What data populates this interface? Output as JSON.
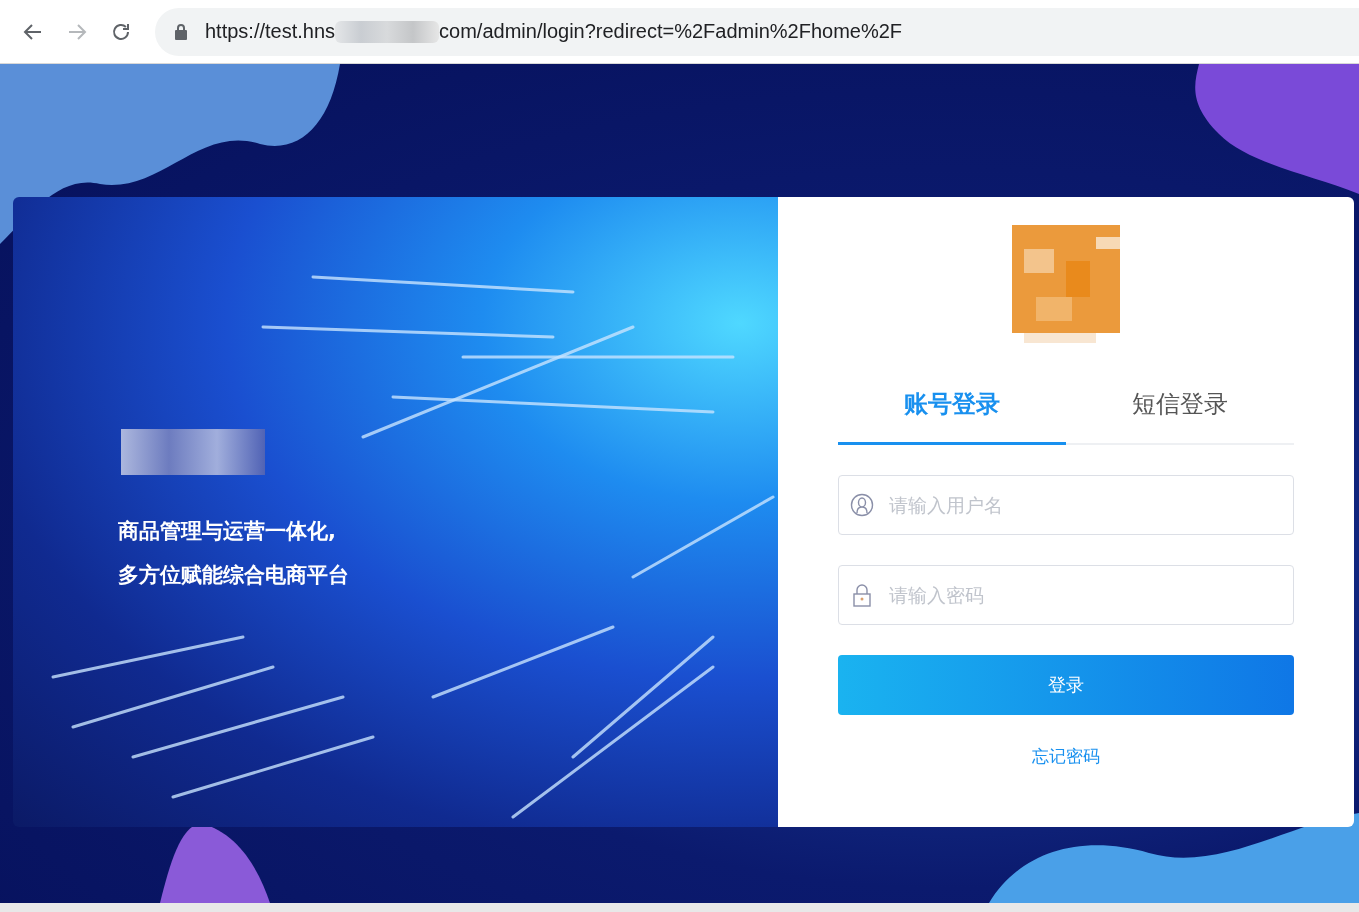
{
  "browser": {
    "url_start": "https://test.hns",
    "url_end": "com/admin/login?redirect=%2Fadmin%2Fhome%2F"
  },
  "banner": {
    "lines": [
      "商品管理与运营一体化,",
      "多方位赋能综合电商平台"
    ]
  },
  "tabs": [
    {
      "label": "账号登录",
      "selected": true
    },
    {
      "label": "短信登录",
      "selected": false
    }
  ],
  "fields": [
    {
      "kind": "user",
      "placeholder": "请输入用户名"
    },
    {
      "kind": "password",
      "placeholder": "请输入密码"
    }
  ],
  "login_button": "登录",
  "forgot_link": "忘记密码"
}
